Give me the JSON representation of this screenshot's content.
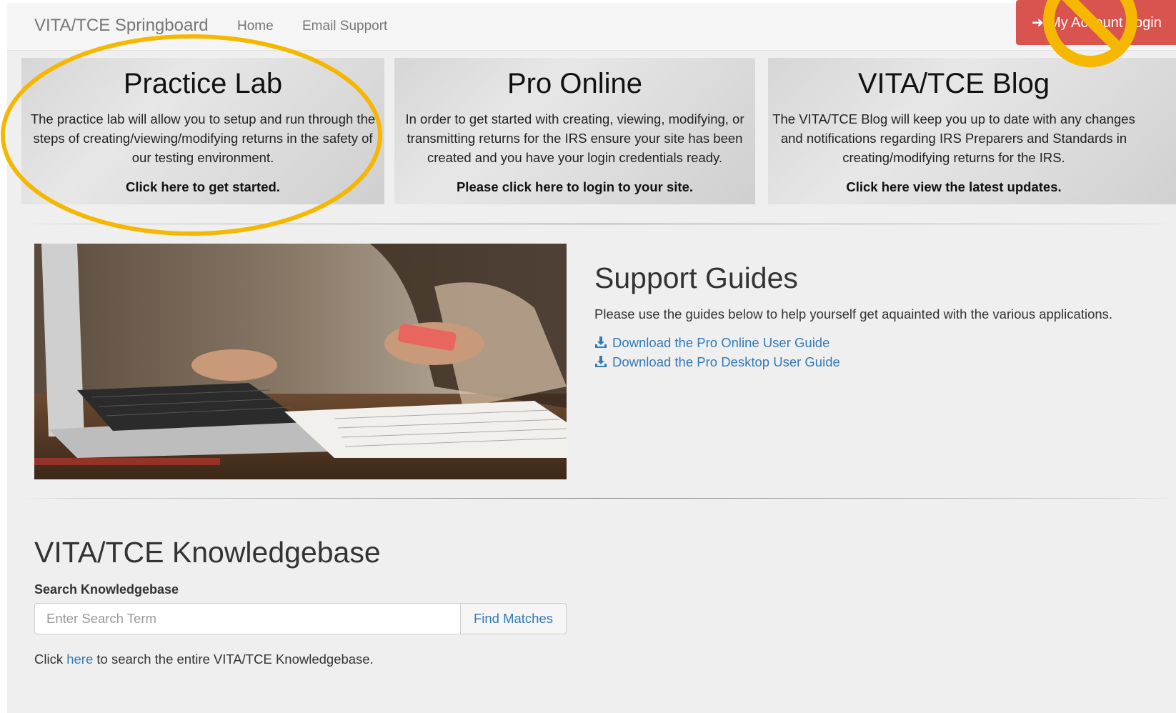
{
  "navbar": {
    "brand": "VITA/TCE Springboard",
    "links": [
      "Home",
      "Email Support"
    ],
    "login_label": "My Account Login"
  },
  "cards": [
    {
      "title": "Practice Lab",
      "body": "The practice lab will allow you to setup and run through the steps of creating/viewing/modifying returns in the safety of our testing environment.",
      "link": "Click here to get started."
    },
    {
      "title": "Pro Online",
      "body": "In order to get started with creating, viewing, modifying, or transmitting returns for the IRS ensure your site has been created and you have your login credentials ready.",
      "link": "Please click here to login to your site."
    },
    {
      "title": "VITA/TCE Blog",
      "body": "The VITA/TCE Blog will keep you up to date with any changes and notifications regarding IRS Preparers and Standards in creating/modifying returns for the IRS.",
      "link": "Click here view the latest updates."
    }
  ],
  "support": {
    "title": "Support Guides",
    "intro": "Please use the guides below to help yourself get aquainted with the various applications.",
    "guides": [
      "Download the Pro Online User Guide",
      "Download the Pro Desktop User Guide"
    ]
  },
  "knowledgebase": {
    "title": "VITA/TCE Knowledgebase",
    "search_label": "Search Knowledgebase",
    "search_placeholder": "Enter Search Term",
    "search_value": "",
    "button_label": "Find Matches",
    "footer_prefix": "Click ",
    "footer_link": "here",
    "footer_suffix": " to search the entire VITA/TCE Knowledgebase."
  },
  "annotations": {
    "highlight_color": "#f5b700",
    "accent_blue": "#337ab7",
    "login_red": "#d9534f"
  }
}
